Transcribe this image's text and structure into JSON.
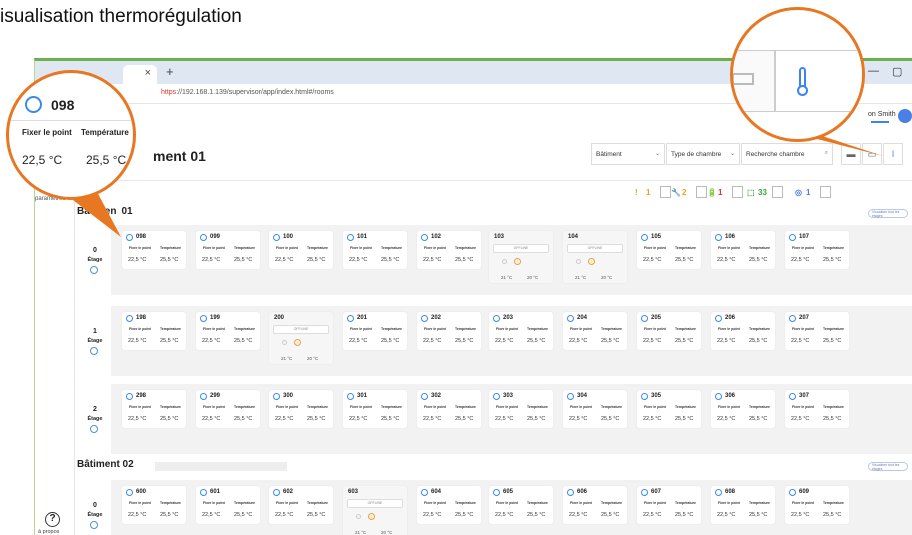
{
  "heading": "isualisation thermorégulation",
  "browser": {
    "tab_close": "×",
    "new_tab": "+",
    "minimize": "—",
    "restore": "▢",
    "close": "✕",
    "url_scheme": "https",
    "url_rest": "://192.168.1.139/supervisor/app/index.html#/rooms"
  },
  "user": {
    "name": "on Smith"
  },
  "sidebar": {
    "settings_label": "paramètres",
    "help_glyph": "?",
    "about_label": "à propos"
  },
  "header": {
    "title": "ment 01"
  },
  "filters": [
    {
      "label": "Bâtiment"
    },
    {
      "label": "Type de chambre"
    },
    {
      "label": "Recherche chambre"
    }
  ],
  "icons": {
    "chevron": "⌄",
    "search": "⌕",
    "grid": "▬",
    "list": "▭",
    "thermo": "🌡"
  },
  "legend": [
    {
      "glyph": "!",
      "count": "1",
      "color": "#f0a020"
    },
    {
      "glyph": "🔧",
      "count": "2",
      "color": "#f0a020"
    },
    {
      "glyph": "🔋",
      "count": "1",
      "color": "#e03030"
    },
    {
      "glyph": "⬚",
      "count": "33",
      "color": "#3aa53a"
    },
    {
      "glyph": "◎",
      "count": "1",
      "color": "#4c7fe6"
    }
  ],
  "labels": {
    "setpoint": "Fixer le point",
    "temperature": "Température",
    "floor": "Étage",
    "offline": "OFFLINE",
    "show_all": "Visualiser tout les étages"
  },
  "buildings": [
    {
      "name": "Bâtimen",
      "name_tail": "01",
      "floors": [
        {
          "number": "0",
          "rooms": [
            {
              "num": "098",
              "setpoint": "22,5 °C",
              "temp": "25,5 °C"
            },
            {
              "num": "099",
              "setpoint": "22,5 °C",
              "temp": "25,5 °C"
            },
            {
              "num": "100",
              "setpoint": "22,5 °C",
              "temp": "25,5 °C"
            },
            {
              "num": "101",
              "setpoint": "22,5 °C",
              "temp": "25,5 °C"
            },
            {
              "num": "102",
              "setpoint": "22,5 °C",
              "temp": "25,5 °C"
            },
            {
              "num": "103",
              "offline": true,
              "setpoint": "21 °C",
              "temp": "20 °C"
            },
            {
              "num": "104",
              "offline": true,
              "setpoint": "21 °C",
              "temp": "20 °C"
            },
            {
              "num": "105",
              "setpoint": "22,5 °C",
              "temp": "25,5 °C"
            },
            {
              "num": "106",
              "setpoint": "22,5 °C",
              "temp": "25,5 °C"
            },
            {
              "num": "107",
              "setpoint": "22,5 °C",
              "temp": "25,5 °C"
            }
          ]
        },
        {
          "number": "1",
          "rooms": [
            {
              "num": "198",
              "setpoint": "22,5 °C",
              "temp": "25,5 °C"
            },
            {
              "num": "199",
              "setpoint": "22,5 °C",
              "temp": "25,5 °C"
            },
            {
              "num": "200",
              "offline": true,
              "setpoint": "21 °C",
              "temp": "20 °C"
            },
            {
              "num": "201",
              "setpoint": "22,5 °C",
              "temp": "25,5 °C"
            },
            {
              "num": "202",
              "setpoint": "22,5 °C",
              "temp": "25,5 °C"
            },
            {
              "num": "203",
              "setpoint": "22,5 °C",
              "temp": "25,5 °C"
            },
            {
              "num": "204",
              "setpoint": "22,5 °C",
              "temp": "25,5 °C"
            },
            {
              "num": "205",
              "setpoint": "22,5 °C",
              "temp": "25,5 °C"
            },
            {
              "num": "206",
              "setpoint": "22,5 °C",
              "temp": "25,5 °C"
            },
            {
              "num": "207",
              "setpoint": "22,5 °C",
              "temp": "25,5 °C"
            }
          ]
        },
        {
          "number": "2",
          "rooms": [
            {
              "num": "298",
              "setpoint": "22,5 °C",
              "temp": "25,5 °C"
            },
            {
              "num": "299",
              "setpoint": "22,5 °C",
              "temp": "25,5 °C"
            },
            {
              "num": "300",
              "setpoint": "22,5 °C",
              "temp": "25,5 °C"
            },
            {
              "num": "301",
              "setpoint": "22,5 °C",
              "temp": "25,5 °C"
            },
            {
              "num": "302",
              "setpoint": "22,5 °C",
              "temp": "25,5 °C"
            },
            {
              "num": "303",
              "setpoint": "22,5 °C",
              "temp": "25,5 °C"
            },
            {
              "num": "304",
              "setpoint": "22,5 °C",
              "temp": "25,5 °C"
            },
            {
              "num": "305",
              "setpoint": "22,5 °C",
              "temp": "25,5 °C"
            },
            {
              "num": "306",
              "setpoint": "22,5 °C",
              "temp": "25,5 °C"
            },
            {
              "num": "307",
              "setpoint": "22,5 °C",
              "temp": "25,5 °C"
            }
          ]
        }
      ]
    },
    {
      "name": "Bâtiment 02",
      "floors": [
        {
          "number": "0",
          "rooms": [
            {
              "num": "600",
              "setpoint": "22,5 °C",
              "temp": "25,5 °C"
            },
            {
              "num": "601",
              "setpoint": "22,5 °C",
              "temp": "25,5 °C"
            },
            {
              "num": "602",
              "setpoint": "22,5 °C",
              "temp": "25,5 °C"
            },
            {
              "num": "603",
              "offline": true,
              "setpoint": "21 °C",
              "temp": "20 °C"
            },
            {
              "num": "604",
              "setpoint": "22,5 °C",
              "temp": "25,5 °C"
            },
            {
              "num": "605",
              "setpoint": "22,5 °C",
              "temp": "25,5 °C"
            },
            {
              "num": "606",
              "setpoint": "22,5 °C",
              "temp": "25,5 °C"
            },
            {
              "num": "607",
              "setpoint": "22,5 °C",
              "temp": "25,5 °C"
            },
            {
              "num": "608",
              "setpoint": "22,5 °C",
              "temp": "25,5 °C"
            },
            {
              "num": "609",
              "setpoint": "22,5 °C",
              "temp": "25,5 °C"
            }
          ]
        }
      ]
    }
  ],
  "zoom_left": {
    "room": "098",
    "setpoint_label": "Fixer le point",
    "temp_label": "Température",
    "setpoint": "22,5 °C",
    "temp": "25,5 °C"
  },
  "accent": "#e87722"
}
